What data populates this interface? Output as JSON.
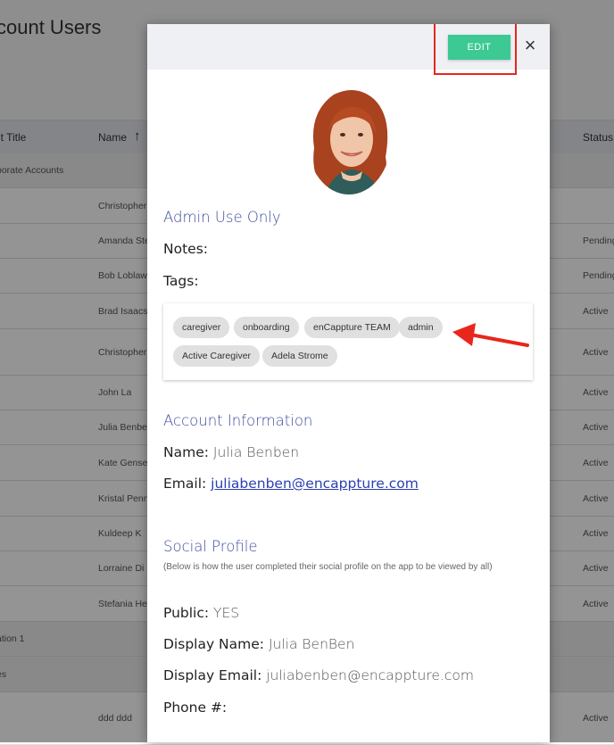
{
  "background": {
    "page_title": "count Users",
    "columns": [
      "it Title",
      "Name",
      "Status"
    ],
    "rows": [
      {
        "title": "porate Accounts",
        "name": "",
        "status": "",
        "group": true
      },
      {
        "title": "",
        "name": "Christopher",
        "status": "",
        "group": false
      },
      {
        "title": "",
        "name": "Amanda Ste",
        "status": "Pending",
        "group": false
      },
      {
        "title": "",
        "name": "Bob Loblaw",
        "status": "Pending",
        "group": false
      },
      {
        "title": "",
        "name": "Brad Isaacs",
        "status": "Active",
        "group": false
      },
      {
        "title": "",
        "name": "Christopher",
        "status": "Active",
        "group": false
      },
      {
        "title": "",
        "name": "John La",
        "status": "Active",
        "group": false
      },
      {
        "title": "",
        "name": "Julia Benbe",
        "status": "Active",
        "group": false
      },
      {
        "title": "",
        "name": "Kate Gense",
        "status": "Active",
        "group": false
      },
      {
        "title": "",
        "name": "Kristal Penn",
        "status": "Active",
        "group": false
      },
      {
        "title": "",
        "name": "Kuldeep K",
        "status": "Active",
        "group": false
      },
      {
        "title": "",
        "name": "Lorraine Di",
        "status": "Active",
        "group": false
      },
      {
        "title": "",
        "name": "Stefania He",
        "status": "Active",
        "group": false
      },
      {
        "title": "ation 1",
        "name": "",
        "status": "",
        "group": true
      },
      {
        "title": "es",
        "name": "",
        "status": "",
        "group": true
      },
      {
        "title": "",
        "name": "ddd ddd",
        "status": "Active",
        "group": false
      }
    ]
  },
  "modal": {
    "edit_label": "EDIT",
    "close_symbol": "×",
    "admin_section_title": "Admin Use Only",
    "notes_label": "Notes:",
    "tags_label": "Tags:",
    "tags": [
      "caregiver",
      "onboarding",
      "enCappture TEAM",
      "admin",
      "Active Caregiver",
      "Adela Strome"
    ],
    "account_section_title": "Account Information",
    "name_label": "Name:",
    "name_value": "Julia Benben",
    "email_label": "Email:",
    "email_value": "juliabenben@encappture.com",
    "social_section_title": "Social Profile",
    "social_note": "(Below is how the user completed their social profile on the app to be viewed by all)",
    "public_label": "Public:",
    "public_value": "YES",
    "display_name_label": "Display Name:",
    "display_name_value": "Julia BenBen",
    "display_email_label": "Display Email:",
    "display_email_value": "juliabenben@encappture.com",
    "phone_label": "Phone #:"
  },
  "colors": {
    "edit_button": "#3cc993",
    "section_title": "#3f4ea0",
    "annotation_red": "#e8261c",
    "link": "#2a3fb4"
  }
}
